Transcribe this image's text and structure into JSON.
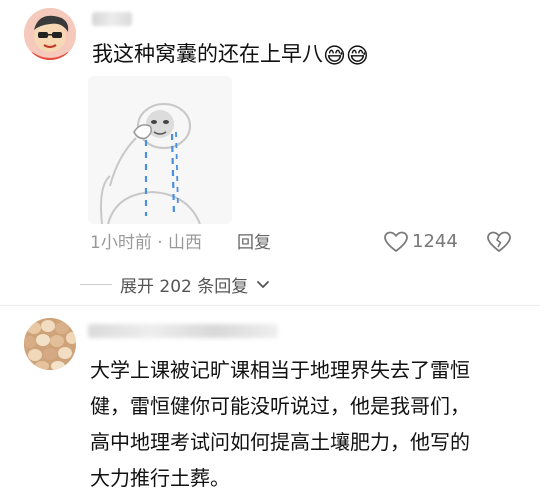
{
  "comments": [
    {
      "text": "我这种窝囊的还在上早八",
      "emojis": "😅😅",
      "meta": "1小时前 · 山西",
      "reply_label": "回复",
      "likes": "1244",
      "expand_label": "展开 202 条回复"
    },
    {
      "lines": [
        "大学上课被记旷课相当于地理界失去了雷恒",
        "健，雷恒健你可能没听说过，他是我哥们，",
        "高中地理考试问如何提高土壤肥力，他写的",
        "大力推行土葬。"
      ]
    }
  ],
  "icons": {
    "like": "heart-icon",
    "dislike": "broken-heart-icon",
    "expand": "chevron-down-icon"
  },
  "colors": {
    "meta_gray": "#999999",
    "text": "#111111",
    "tear_blue": "#4a90e2"
  }
}
